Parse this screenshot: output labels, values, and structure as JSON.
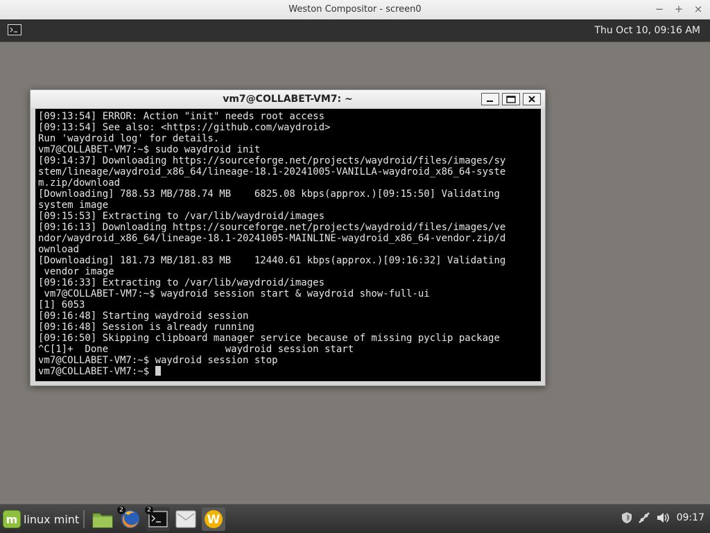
{
  "outer_window": {
    "title": "Weston Compositor - screen0",
    "controls": [
      "−",
      "+",
      "×"
    ]
  },
  "weston_panel": {
    "launcher_icon": "terminal-icon",
    "clock": "Thu Oct 10, 09:16 AM"
  },
  "terminal": {
    "title": "vm7@COLLABET-VM7: ~",
    "lines": [
      "[09:13:54] ERROR: Action \"init\" needs root access",
      "[09:13:54] See also: <https://github.com/waydroid>",
      "Run 'waydroid log' for details.",
      "vm7@COLLABET-VM7:~$ sudo waydroid init",
      "[09:14:37] Downloading https://sourceforge.net/projects/waydroid/files/images/sy",
      "stem/lineage/waydroid_x86_64/lineage-18.1-20241005-VANILLA-waydroid_x86_64-syste",
      "m.zip/download",
      "[Downloading] 788.53 MB/788.74 MB    6825.08 kbps(approx.)[09:15:50] Validating",
      "system image",
      "[09:15:53] Extracting to /var/lib/waydroid/images",
      "[09:16:13] Downloading https://sourceforge.net/projects/waydroid/files/images/ve",
      "ndor/waydroid_x86_64/lineage-18.1-20241005-MAINLINE-waydroid_x86_64-vendor.zip/d",
      "ownload",
      "[Downloading] 181.73 MB/181.83 MB    12440.61 kbps(approx.)[09:16:32] Validating",
      " vendor image",
      "[09:16:33] Extracting to /var/lib/waydroid/images",
      " vm7@COLLABET-VM7:~$ waydroid session start & waydroid show-full-ui",
      "[1] 6053",
      "[09:16:48] Starting waydroid session",
      "[09:16:48] Session is already running",
      "[09:16:50] Skipping clipboard manager service because of missing pyclip package",
      "^C[1]+  Done                    waydroid session start",
      "vm7@COLLABET-VM7:~$ waydroid session stop"
    ],
    "prompt": "vm7@COLLABET-VM7:~$ "
  },
  "taskbar": {
    "menu_label": "linux mint",
    "apps": [
      {
        "icon": "folder-icon",
        "badge": ""
      },
      {
        "icon": "firefox-icon",
        "badge": "2"
      },
      {
        "icon": "terminal-icon",
        "badge": "2"
      },
      {
        "icon": "mail-icon",
        "badge": ""
      },
      {
        "icon": "waydroid-icon",
        "badge": ""
      }
    ],
    "tray_icons": [
      "shield-icon",
      "network-icon",
      "volume-icon"
    ],
    "clock": "09:17"
  }
}
